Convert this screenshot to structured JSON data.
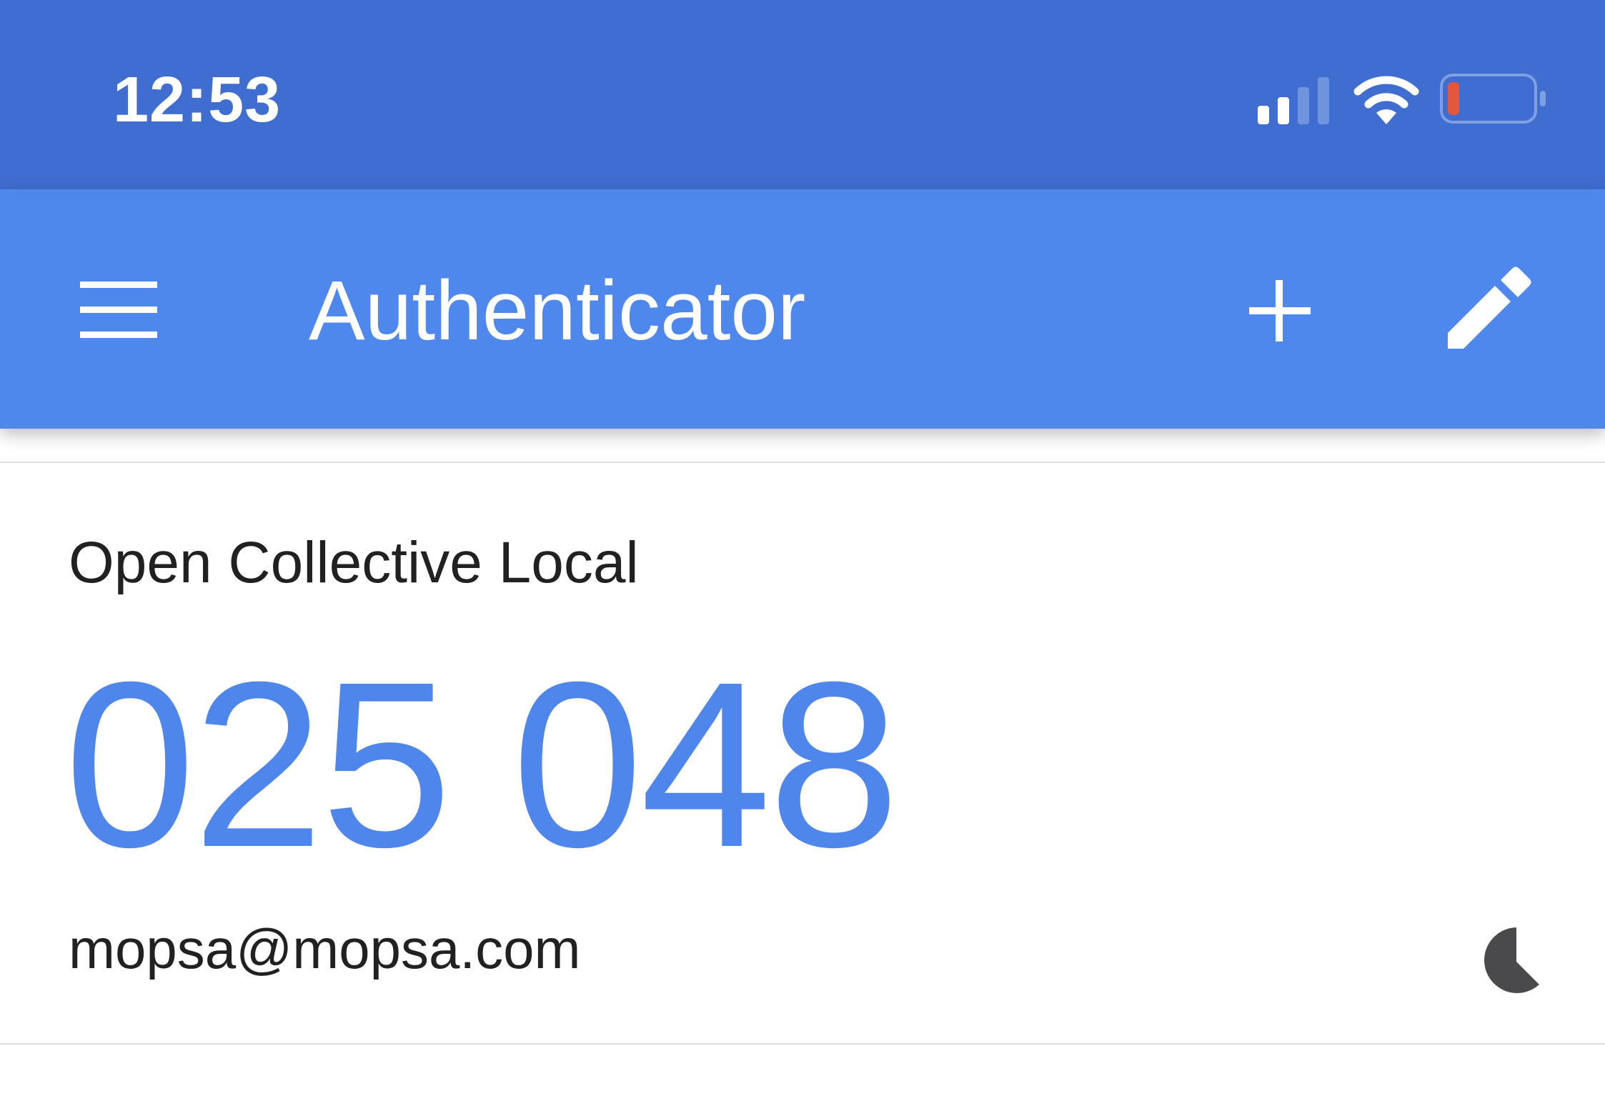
{
  "status_bar": {
    "time": "12:53",
    "icons": [
      "signal-icon",
      "wifi-icon",
      "battery-icon"
    ],
    "battery_level": 0.08,
    "battery_color": "#e4573d"
  },
  "app_bar": {
    "title": "Authenticator",
    "menu_icon": "hamburger-menu-icon",
    "add_icon": "plus-icon",
    "edit_icon": "pencil-icon",
    "background_color": "#4f88ec"
  },
  "accounts": [
    {
      "issuer": "Open Collective Local",
      "code": "025 048",
      "account": "mopsa@mopsa.com",
      "timer_icon": "countdown-timer-icon",
      "code_color": "#4f86ec"
    }
  ]
}
